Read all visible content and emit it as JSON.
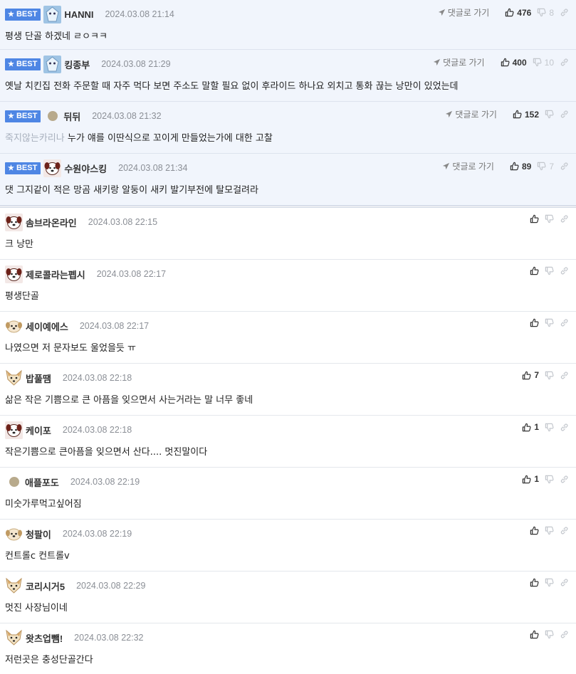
{
  "reply_label": "댓글로 가기",
  "best_label": "BEST",
  "comments": [
    {
      "id": "best-1",
      "best": true,
      "avatar": "snowflake",
      "nick": "HANNI",
      "date": "2024.03.08 21:14",
      "text": "평생 단골 하겠네 ㄹㅇㅋㅋ",
      "prefix": "",
      "up": "476",
      "down": "8"
    },
    {
      "id": "best-2",
      "best": true,
      "avatar": "snowflake",
      "nick": "킹종부",
      "date": "2024.03.08 21:29",
      "text": "옛날 치킨집 전화 주문할 때 자주 먹다 보면 주소도 말할 필요 없이 후라이드 하나요 외치고 통화 끊는 낭만이 있었는데",
      "prefix": "",
      "up": "400",
      "down": "10"
    },
    {
      "id": "best-3",
      "best": true,
      "avatar": "dot",
      "nick": "뒤뒤",
      "date": "2024.03.08 21:32",
      "text": "누가 얘를 이딴식으로 꼬이게 만들었는가에 대한 고찰",
      "prefix": "죽지않는카리나",
      "up": "152",
      "down": ""
    },
    {
      "id": "best-4",
      "best": true,
      "avatar": "dog-red",
      "nick": "수원야스킹",
      "date": "2024.03.08 21:34",
      "text": "댓 그지같이 적은 망곰 새키랑 알둥이 새키 발기부전에 탈모걸려라",
      "prefix": "",
      "up": "89",
      "down": "7"
    },
    {
      "id": "c-1",
      "best": false,
      "avatar": "dog-red",
      "nick": "솜브라온라인",
      "date": "2024.03.08 22:15",
      "text": "크 낭만",
      "prefix": "",
      "up": "",
      "down": ""
    },
    {
      "id": "c-2",
      "best": false,
      "avatar": "dog-red",
      "nick": "제로콜라는펩시",
      "date": "2024.03.08 22:17",
      "text": "평생단골",
      "prefix": "",
      "up": "",
      "down": ""
    },
    {
      "id": "c-3",
      "best": false,
      "avatar": "puppy",
      "nick": "세이예에스",
      "date": "2024.03.08 22:17",
      "text": "나였으면 저 문자보도 울었을듯 ㅠ",
      "prefix": "",
      "up": "",
      "down": ""
    },
    {
      "id": "c-4",
      "best": false,
      "avatar": "fox",
      "nick": "밥풀땜",
      "date": "2024.03.08 22:18",
      "text": "삶은 작은 기쁨으로 큰 아픔을 잊으면서 사는거라는 말 너무 좋네",
      "prefix": "",
      "up": "7",
      "down": ""
    },
    {
      "id": "c-5",
      "best": false,
      "avatar": "dog-red",
      "nick": "케이포",
      "date": "2024.03.08 22:18",
      "text": "작은기쁨으로 큰아픔을 잊으면서 산다.... 멋진말이다",
      "prefix": "",
      "up": "1",
      "down": ""
    },
    {
      "id": "c-6",
      "best": false,
      "avatar": "dot",
      "nick": "애플포도",
      "date": "2024.03.08 22:19",
      "text": "미숫가루먹고싶어짐",
      "prefix": "",
      "up": "1",
      "down": ""
    },
    {
      "id": "c-7",
      "best": false,
      "avatar": "puppy",
      "nick": "청팔이",
      "date": "2024.03.08 22:19",
      "text": "컨트롤c 컨트롤v",
      "prefix": "",
      "up": "",
      "down": ""
    },
    {
      "id": "c-8",
      "best": false,
      "avatar": "fox",
      "nick": "코리시거5",
      "date": "2024.03.08 22:29",
      "text": "멋진 사장님이네",
      "prefix": "",
      "up": "",
      "down": ""
    },
    {
      "id": "c-9",
      "best": false,
      "avatar": "fox",
      "nick": "왓츠업뺌!",
      "date": "2024.03.08 22:32",
      "text": "저런곳은 충성단골간다",
      "prefix": "",
      "up": "",
      "down": ""
    }
  ],
  "colors": {
    "best_badge": "#4e86e4",
    "best_bg": "#f1f5fc",
    "meta": "#8b8f96",
    "faded_prefix": "#a8b0bd"
  }
}
